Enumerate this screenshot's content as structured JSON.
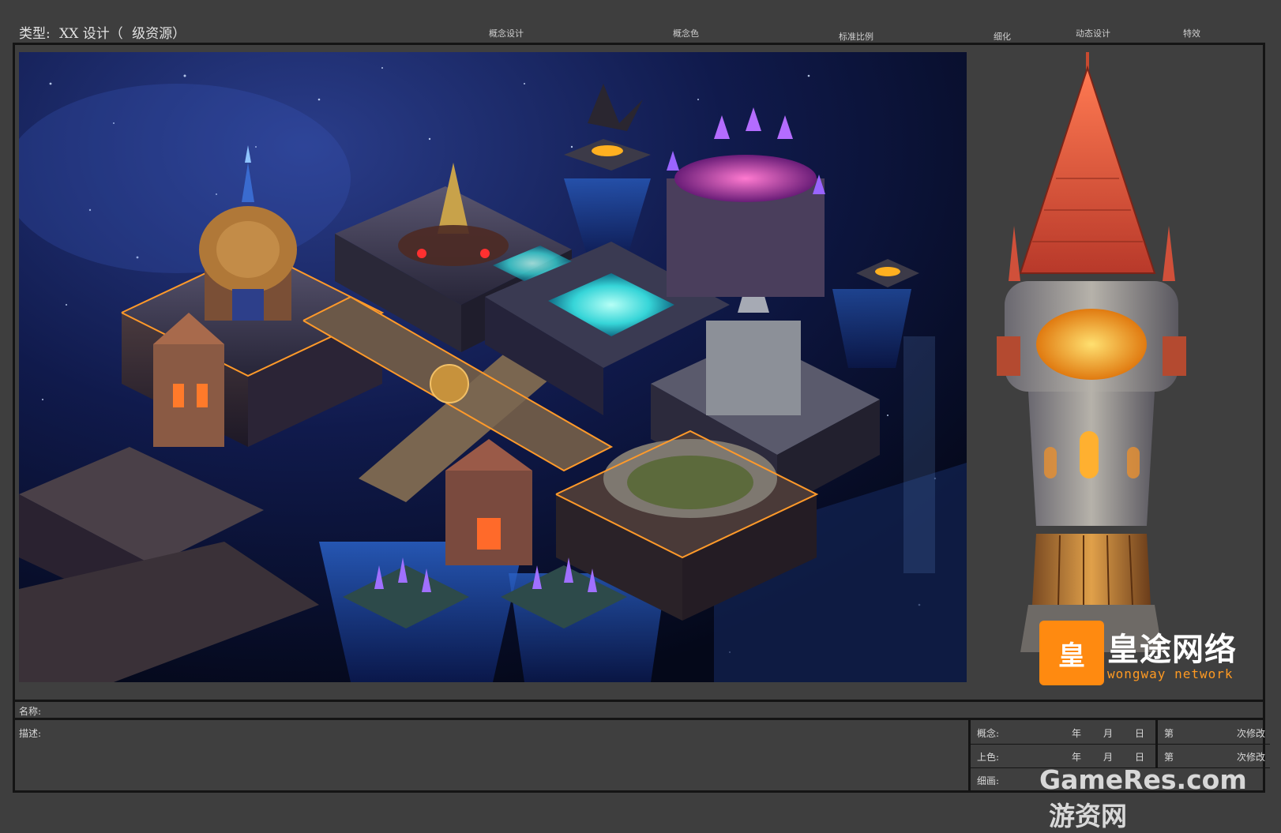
{
  "header": {
    "type_label": "类型:",
    "type_value": "XX 设计（",
    "type_level": "级资源）",
    "stages": [
      "概念设计",
      "概念色",
      "标准比例",
      "细化",
      "动态设计",
      "特效"
    ]
  },
  "logo": {
    "mark": "皇",
    "name_cn": "皇途网络",
    "name_en": "wongway network"
  },
  "form": {
    "name_label": "名称:",
    "desc_label": "描述:",
    "rows": [
      {
        "label": "概念:",
        "year": "年",
        "month": "月",
        "day": "日"
      },
      {
        "label": "上色:",
        "year": "年",
        "month": "月",
        "day": "日"
      },
      {
        "label": "细画:",
        "year": "",
        "month": "",
        "day": ""
      }
    ],
    "revisions": [
      {
        "prefix": "第",
        "suffix": "次修改"
      },
      {
        "prefix": "第",
        "suffix": "次修改"
      }
    ]
  },
  "watermark": {
    "en": "GameRes.com",
    "cn": "游资网"
  },
  "colors": {
    "background": "#3e3e3e",
    "border": "#141414",
    "accent": "#ff8a10"
  }
}
